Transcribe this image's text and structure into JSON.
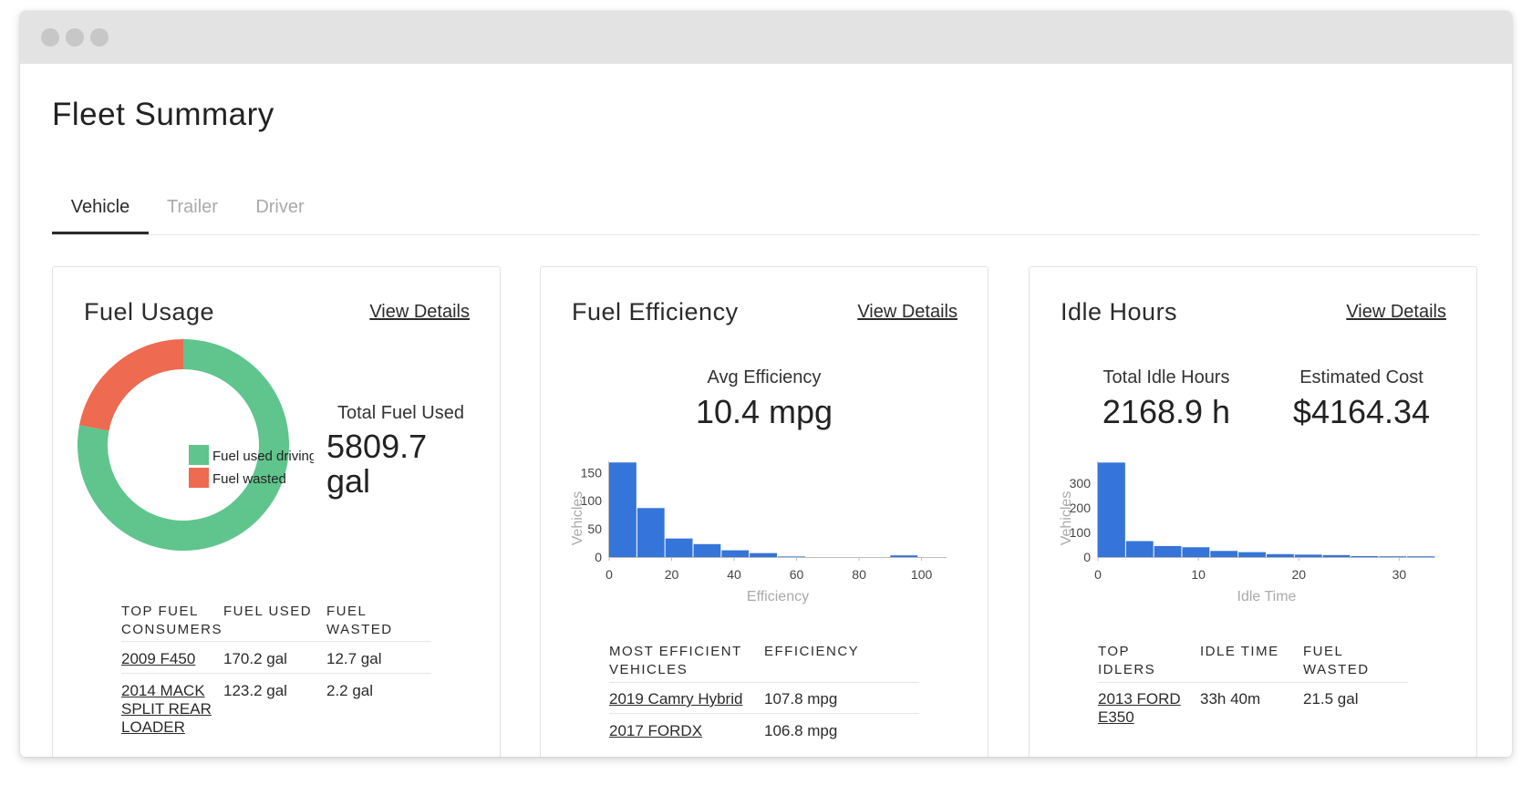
{
  "page_title": "Fleet Summary",
  "tabs": [
    {
      "label": "Vehicle",
      "active": true
    },
    {
      "label": "Trailer",
      "active": false
    },
    {
      "label": "Driver",
      "active": false
    }
  ],
  "colors": {
    "fuel_used_driving": "#5fc58c",
    "fuel_wasted": "#ee6a50",
    "histogram_bar": "#3574d9"
  },
  "fuel_usage": {
    "title": "Fuel Usage",
    "view_details": "View Details",
    "total_label": "Total Fuel Used",
    "total_value": "5809.7",
    "total_unit": "gal",
    "legend": [
      "Fuel used driving",
      "Fuel wasted"
    ],
    "table": {
      "headers": [
        "TOP FUEL CONSUMERS",
        "FUEL USED",
        "FUEL WASTED"
      ],
      "rows": [
        {
          "vehicle": "2009 F450",
          "used": "170.2 gal",
          "wasted": "12.7 gal"
        },
        {
          "vehicle": "2014 MACK SPLIT REAR LOADER",
          "used": "123.2 gal",
          "wasted": "2.2 gal"
        }
      ]
    }
  },
  "fuel_efficiency": {
    "title": "Fuel Efficiency",
    "view_details": "View Details",
    "avg_label": "Avg Efficiency",
    "avg_value": "10.4 mpg",
    "table": {
      "headers": [
        "MOST EFFICIENT VEHICLES",
        "EFFICIENCY"
      ],
      "rows": [
        {
          "vehicle": "2019 Camry Hybrid",
          "efficiency": "107.8 mpg"
        },
        {
          "vehicle": "2017 FORDX",
          "efficiency": "106.8 mpg"
        }
      ]
    }
  },
  "idle_hours": {
    "title": "Idle Hours",
    "view_details": "View Details",
    "total_label": "Total Idle Hours",
    "total_value": "2168.9 h",
    "cost_label": "Estimated Cost",
    "cost_value": "$4164.34",
    "table": {
      "headers": [
        "TOP IDLERS",
        "IDLE TIME",
        "FUEL WASTED"
      ],
      "rows": [
        {
          "vehicle": "2013 FORD E350",
          "idle": "33h 40m",
          "wasted": "21.5 gal"
        }
      ]
    }
  },
  "chart_data": [
    {
      "type": "pie",
      "donut": true,
      "labels": [
        "Fuel used driving",
        "Fuel wasted"
      ],
      "values": [
        78,
        22
      ],
      "unit": "percent of total"
    },
    {
      "type": "bar",
      "histogram": true,
      "xlabel": "Efficiency",
      "ylabel": "Vehicles",
      "bin_width": 9,
      "x_start": 0,
      "values": [
        168,
        87,
        33,
        23,
        12,
        7,
        1,
        0,
        0,
        0,
        3
      ],
      "xticks": [
        0,
        20,
        40,
        60,
        80,
        100
      ],
      "yticks": [
        0,
        50,
        100,
        150
      ],
      "xlim": [
        0,
        108
      ],
      "ylim": [
        0,
        170
      ]
    },
    {
      "type": "bar",
      "histogram": true,
      "xlabel": "Idle Time",
      "ylabel": "Vehicles",
      "bin_width": 2.8,
      "x_start": 0,
      "values": [
        385,
        65,
        45,
        40,
        25,
        20,
        12,
        10,
        8,
        4,
        3,
        3
      ],
      "xticks": [
        0,
        10,
        20,
        30
      ],
      "yticks": [
        0,
        100,
        200,
        300
      ],
      "xlim": [
        0,
        33.6
      ],
      "ylim": [
        0,
        390
      ]
    }
  ]
}
